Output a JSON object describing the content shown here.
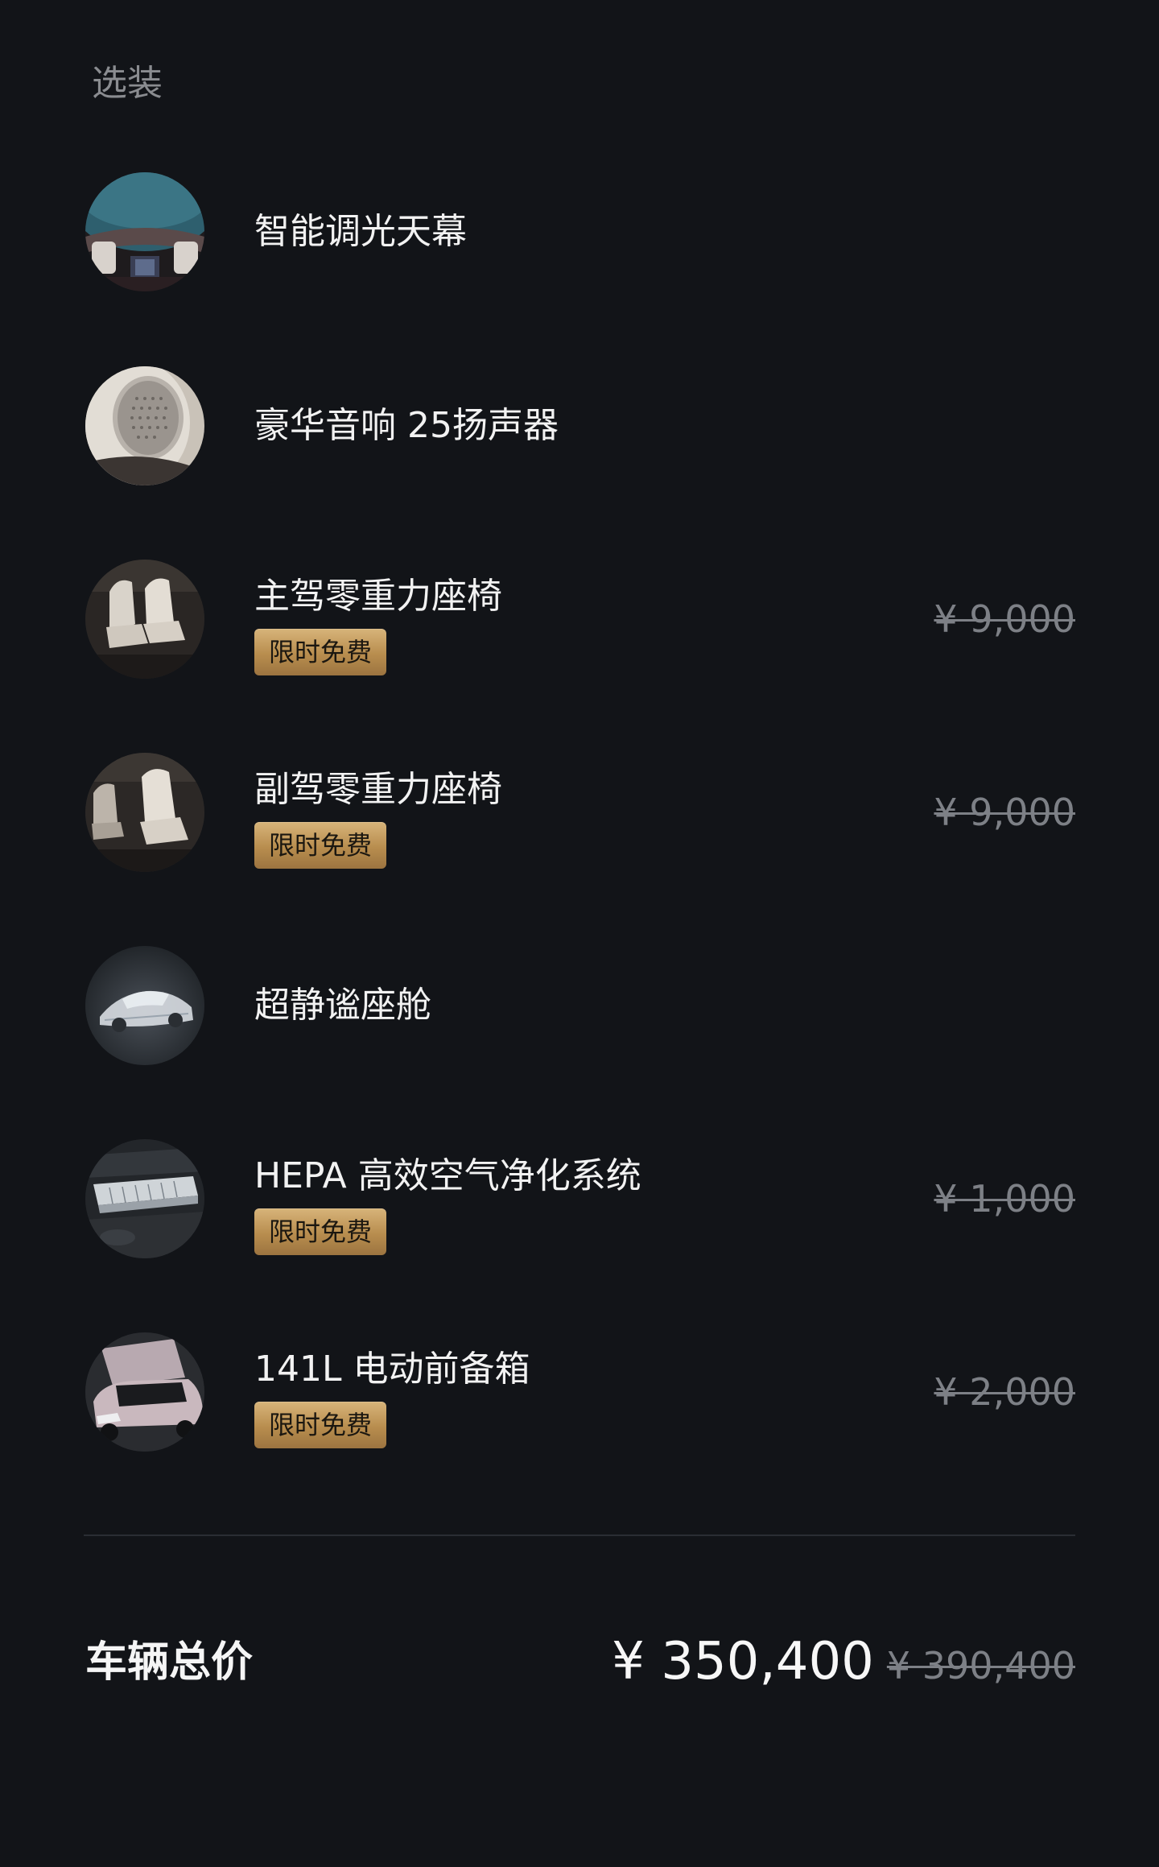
{
  "section": {
    "title": "选装"
  },
  "options": [
    {
      "name": "智能调光天幕",
      "icon": "panoramic-sunroof-thumbnail"
    },
    {
      "name": "豪华音响 25扬声器",
      "icon": "speaker-grille-thumbnail"
    },
    {
      "name": "主驾零重力座椅",
      "badge": "限时免费",
      "original_price": "¥ 9,000",
      "icon": "driver-seat-thumbnail"
    },
    {
      "name": "副驾零重力座椅",
      "badge": "限时免费",
      "original_price": "¥ 9,000",
      "icon": "passenger-seat-thumbnail"
    },
    {
      "name": "超静谧座舱",
      "icon": "quiet-cabin-car-thumbnail"
    },
    {
      "name": "HEPA 高效空气净化系统",
      "badge": "限时免费",
      "original_price": "¥ 1,000",
      "icon": "air-filter-thumbnail"
    },
    {
      "name": "141L 电动前备箱",
      "badge": "限时免费",
      "original_price": "¥ 2,000",
      "icon": "front-trunk-thumbnail"
    }
  ],
  "summary": {
    "label": "车辆总价",
    "price": "¥ 350,400",
    "original_price": "¥ 390,400"
  },
  "colors": {
    "background": "#121418",
    "badge_gold": "#c9a366",
    "muted_text": "#7d8086"
  }
}
